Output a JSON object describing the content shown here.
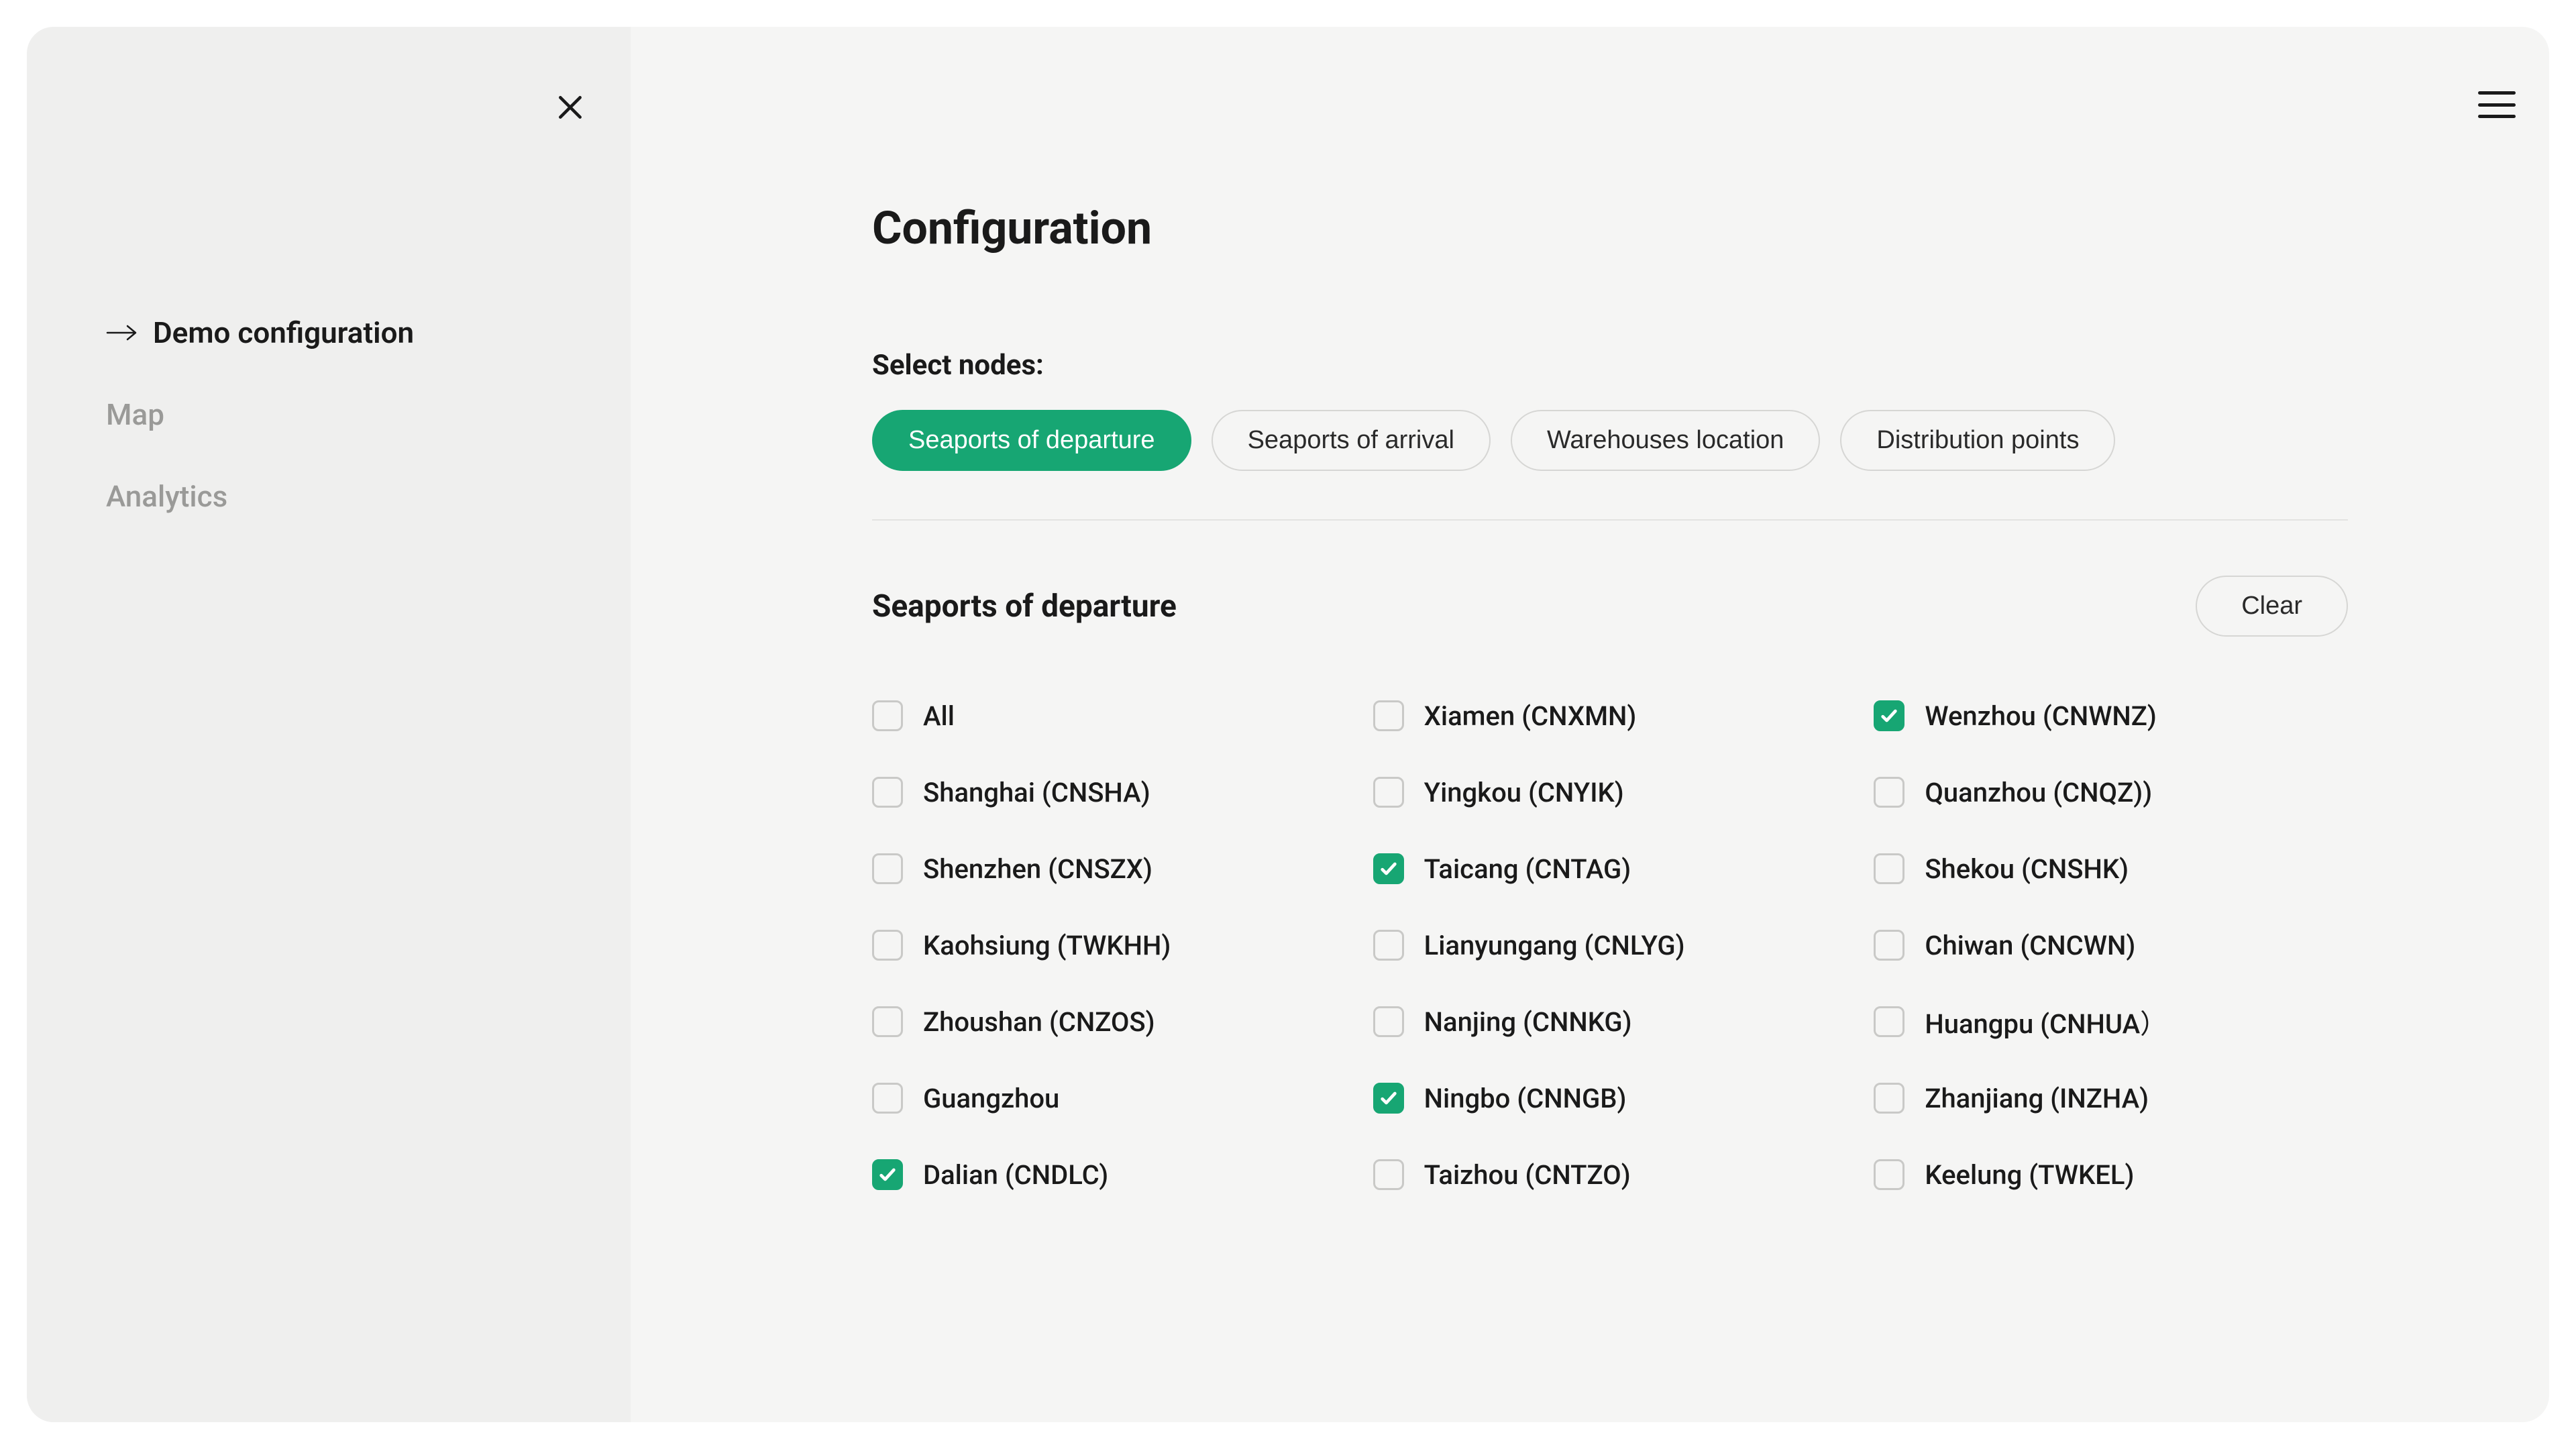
{
  "colors": {
    "accent": "#17a673"
  },
  "sidebar": {
    "items": [
      {
        "label": "Demo configuration",
        "active": true
      },
      {
        "label": "Map",
        "active": false
      },
      {
        "label": "Analytics",
        "active": false
      }
    ]
  },
  "header": {
    "title": "Configuration"
  },
  "nodes": {
    "label": "Select nodes:",
    "tabs": [
      {
        "label": "Seaports of departure",
        "active": true
      },
      {
        "label": "Seaports of arrival",
        "active": false
      },
      {
        "label": "Warehouses location",
        "active": false
      },
      {
        "label": "Distribution points",
        "active": false
      }
    ]
  },
  "section": {
    "title": "Seaports of departure",
    "clear_label": "Clear",
    "items": [
      {
        "label": "All",
        "checked": false
      },
      {
        "label": "Shanghai (CNSHA)",
        "checked": false
      },
      {
        "label": "Shenzhen (CNSZX)",
        "checked": false
      },
      {
        "label": "Kaohsiung (TWKHH)",
        "checked": false
      },
      {
        "label": "Zhoushan (CNZOS)",
        "checked": false
      },
      {
        "label": "Guangzhou",
        "checked": false
      },
      {
        "label": "Dalian (CNDLC)",
        "checked": true
      },
      {
        "label": "Xiamen (CNXMN)",
        "checked": false
      },
      {
        "label": "Yingkou (CNYIK)",
        "checked": false
      },
      {
        "label": "Taicang (CNTAG)",
        "checked": true
      },
      {
        "label": "Lianyungang (CNLYG)",
        "checked": false
      },
      {
        "label": "Nanjing (CNNKG)",
        "checked": false
      },
      {
        "label": "Ningbo (CNNGB)",
        "checked": true
      },
      {
        "label": "Taizhou (CNTZO)",
        "checked": false
      },
      {
        "label": "Wenzhou (CNWNZ)",
        "checked": true
      },
      {
        "label": "Quanzhou (CNQZ))",
        "checked": false
      },
      {
        "label": "Shekou (CNSHK)",
        "checked": false
      },
      {
        "label": "Chiwan (CNCWN)",
        "checked": false
      },
      {
        "label": "Huangpu (CNHUA）",
        "checked": false
      },
      {
        "label": "Zhanjiang (INZHA)",
        "checked": false
      },
      {
        "label": "Keelung (TWKEL)",
        "checked": false
      }
    ]
  }
}
